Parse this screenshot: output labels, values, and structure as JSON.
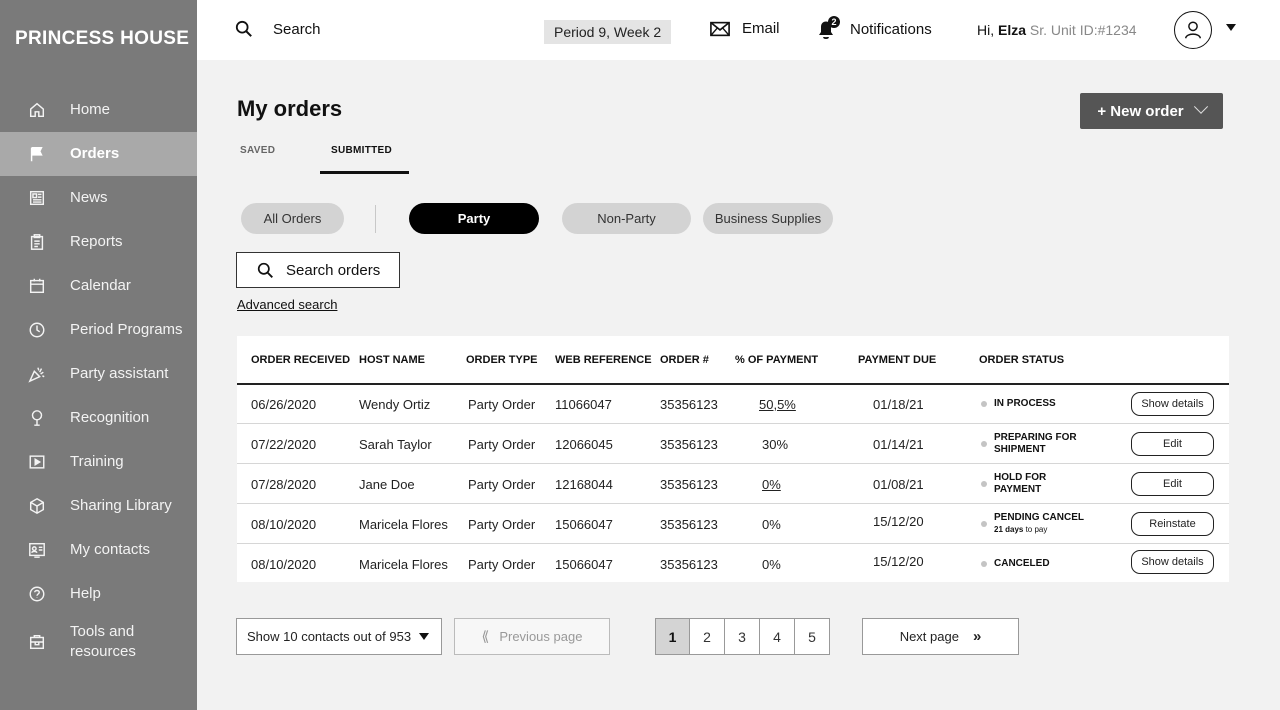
{
  "brand": "PRINCESS HOUSE",
  "sidebar": {
    "items": [
      {
        "label": "Home",
        "icon": "home-icon"
      },
      {
        "label": "Orders",
        "icon": "flag-icon",
        "active": true
      },
      {
        "label": "News",
        "icon": "news-icon"
      },
      {
        "label": "Reports",
        "icon": "clipboard-icon"
      },
      {
        "label": "Calendar",
        "icon": "calendar-icon"
      },
      {
        "label": "Period Programs",
        "icon": "clock-icon"
      },
      {
        "label": "Party assistant",
        "icon": "party-popper-icon"
      },
      {
        "label": "Recognition",
        "icon": "award-icon"
      },
      {
        "label": "Training",
        "icon": "play-icon"
      },
      {
        "label": "Sharing Library",
        "icon": "cube-icon"
      },
      {
        "label": "My contacts",
        "icon": "contact-card-icon"
      },
      {
        "label": "Help",
        "icon": "help-icon"
      },
      {
        "label": "Tools and resources",
        "icon": "toolbox-icon"
      }
    ]
  },
  "topbar": {
    "search_label": "Search",
    "period": "Period 9, Week 2",
    "email_label": "Email",
    "notifications_label": "Notifications",
    "notification_count": "2",
    "greeting": "Hi, ",
    "user_name": "Elza",
    "user_meta": " Sr. Unit ID:#1234"
  },
  "main": {
    "title": "My orders",
    "new_order_label": "+  New order",
    "tabs": [
      {
        "label": "SAVED"
      },
      {
        "label": "SUBMITTED",
        "active": true
      }
    ],
    "filters": [
      {
        "label": "All Orders"
      },
      {
        "label": "Party",
        "active": true
      },
      {
        "label": "Non-Party"
      },
      {
        "label": "Business Supplies"
      }
    ],
    "search_orders_label": "Search orders",
    "advanced_search_label": "Advanced search"
  },
  "table": {
    "columns": [
      "ORDER RECEIVED",
      "HOST NAME",
      "ORDER TYPE",
      "WEB REFERENCE",
      "ORDER #",
      "% OF PAYMENT",
      "PAYMENT DUE",
      "ORDER STATUS"
    ],
    "rows": [
      {
        "received": "06/26/2020",
        "host": "Wendy Ortiz",
        "type": "Party Order",
        "web_ref": "11066047",
        "order_no": "35356123",
        "payment_pct": "50,5%",
        "payment_due": "01/18/21",
        "status": "IN PROCESS",
        "status_sub_bold": "",
        "status_sub": "",
        "action": "Show details"
      },
      {
        "received": "07/22/2020",
        "host": "Sarah Taylor",
        "type": "Party Order",
        "web_ref": "12066045",
        "order_no": "35356123",
        "payment_pct": "30%",
        "payment_due": "01/14/21",
        "status": "PREPARING FOR SHIPMENT",
        "status_sub_bold": "",
        "status_sub": "",
        "action": "Edit"
      },
      {
        "received": "07/28/2020",
        "host": "Jane Doe",
        "type": "Party Order",
        "web_ref": "12168044",
        "order_no": "35356123",
        "payment_pct": "0%",
        "payment_due": "01/08/21",
        "status": "HOLD FOR PAYMENT",
        "status_sub_bold": "",
        "status_sub": "",
        "action": "Edit"
      },
      {
        "received": "08/10/2020",
        "host": "Maricela Flores",
        "type": "Party Order",
        "web_ref": "15066047",
        "order_no": "35356123",
        "payment_pct": "0%",
        "payment_due": "15/12/20",
        "status": "PENDING CANCEL",
        "status_sub_bold": "21 days",
        "status_sub": " to pay",
        "action": "Reinstate"
      },
      {
        "received": "08/10/2020",
        "host": "Maricela Flores",
        "type": "Party Order",
        "web_ref": "15066047",
        "order_no": "35356123",
        "payment_pct": "0%",
        "payment_due": "15/12/20",
        "status": "CANCELED",
        "status_sub_bold": "",
        "status_sub": "",
        "action": "Show details"
      }
    ]
  },
  "pagination": {
    "show_label": "Show 10 contacts out of 953",
    "prev_label": "Previous page",
    "next_label": "Next page",
    "pages": [
      "1",
      "2",
      "3",
      "4",
      "5"
    ],
    "current_page": "1"
  }
}
